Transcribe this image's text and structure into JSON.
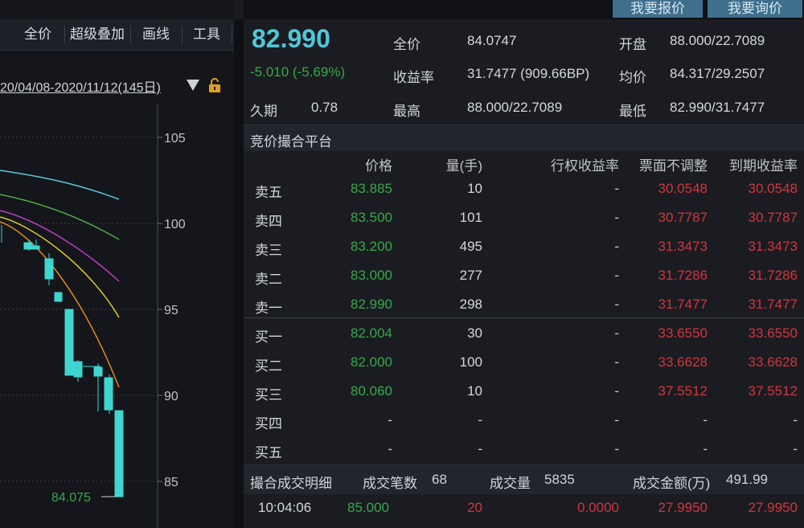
{
  "toolbar": {
    "items": [
      "全价",
      "超级叠加",
      "画线",
      "工具"
    ]
  },
  "chart": {
    "date_range": "20/04/08-2020/11/12(145日)",
    "price_label": "84.075",
    "y_ticks": [
      "105",
      "100",
      "95",
      "90",
      "85"
    ]
  },
  "quote_buttons": [
    "我要报价",
    "我要询价"
  ],
  "quote": {
    "price": "82.990",
    "change": "-5.010 (-5.69%)",
    "duration_label": "久期",
    "duration": "0.78",
    "full_price_label": "全价",
    "full_price": "84.0747",
    "yield_label": "收益率",
    "yield": "31.7477 (909.66BP)",
    "high_label": "最高",
    "high": "88.000/22.7089",
    "open_label": "开盘",
    "open": "88.000/22.7089",
    "avg_label": "均价",
    "avg": "84.317/29.2507",
    "low_label": "最低",
    "low": "82.990/31.7477"
  },
  "book": {
    "title": "竞价撮合平台",
    "headers": [
      "价格",
      "量(手)",
      "行权收益率",
      "票面不调整",
      "到期收益率"
    ],
    "asks": [
      {
        "label": "卖五",
        "price": "83.885",
        "qty": "10",
        "exercise_yield": "-",
        "face": "30.0548",
        "maturity": "30.0548"
      },
      {
        "label": "卖四",
        "price": "83.500",
        "qty": "101",
        "exercise_yield": "-",
        "face": "30.7787",
        "maturity": "30.7787"
      },
      {
        "label": "卖三",
        "price": "83.200",
        "qty": "495",
        "exercise_yield": "-",
        "face": "31.3473",
        "maturity": "31.3473"
      },
      {
        "label": "卖二",
        "price": "83.000",
        "qty": "277",
        "exercise_yield": "-",
        "face": "31.7286",
        "maturity": "31.7286"
      },
      {
        "label": "卖一",
        "price": "82.990",
        "qty": "298",
        "exercise_yield": "-",
        "face": "31.7477",
        "maturity": "31.7477"
      }
    ],
    "bids": [
      {
        "label": "买一",
        "price": "82.004",
        "qty": "30",
        "exercise_yield": "-",
        "face": "33.6550",
        "maturity": "33.6550"
      },
      {
        "label": "买二",
        "price": "82.000",
        "qty": "100",
        "exercise_yield": "-",
        "face": "33.6628",
        "maturity": "33.6628"
      },
      {
        "label": "买三",
        "price": "80.060",
        "qty": "10",
        "exercise_yield": "-",
        "face": "37.5512",
        "maturity": "37.5512"
      },
      {
        "label": "买四",
        "price": "-",
        "qty": "-",
        "exercise_yield": "-",
        "face": "-",
        "maturity": "-"
      },
      {
        "label": "买五",
        "price": "-",
        "qty": "-",
        "exercise_yield": "-",
        "face": "-",
        "maturity": "-"
      }
    ]
  },
  "trades": {
    "title": "撮合成交明细",
    "count_label": "成交笔数",
    "count": "68",
    "volume_label": "成交量",
    "volume": "5835",
    "amount_label": "成交金额(万)",
    "amount": "491.99",
    "rows": [
      {
        "time": "10:04:06",
        "price": "85.000",
        "qty": "20",
        "yield": "0.0000",
        "face": "27.9950",
        "maturity": "27.9950"
      }
    ]
  },
  "colors": {
    "up_green": "#37a84a",
    "down_red": "#d2353d",
    "price_cyan": "#52c7d6",
    "candle": "#3fd6d0"
  }
}
